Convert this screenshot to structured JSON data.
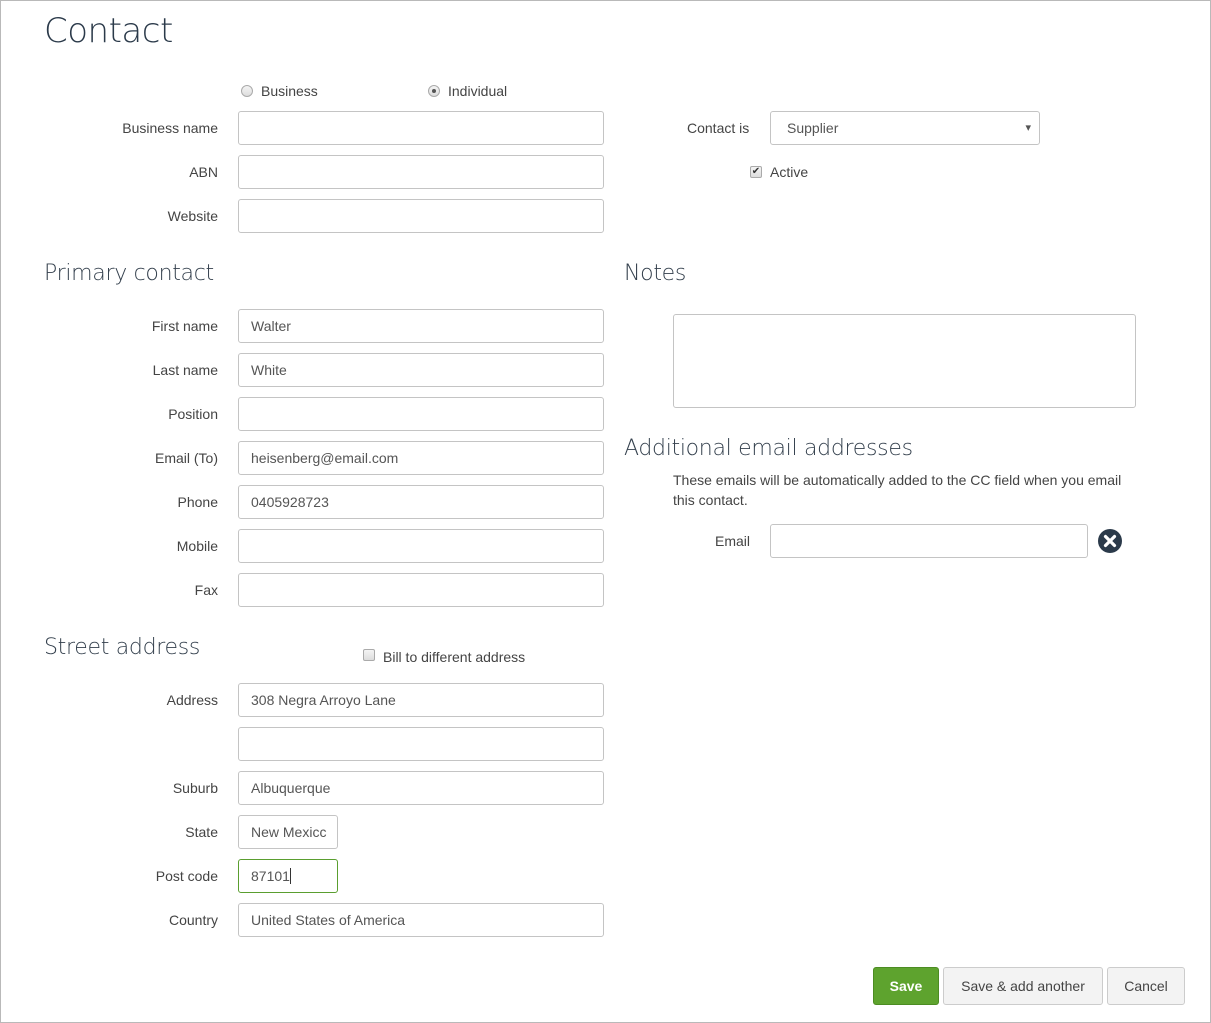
{
  "page": {
    "title": "Contact"
  },
  "contact_type": {
    "options": [
      {
        "label": "Business",
        "selected": false
      },
      {
        "label": "Individual",
        "selected": true
      }
    ]
  },
  "business": {
    "business_name": {
      "label": "Business name",
      "value": ""
    },
    "abn": {
      "label": "ABN",
      "value": ""
    },
    "website": {
      "label": "Website",
      "value": ""
    }
  },
  "contact_is": {
    "label": "Contact is",
    "value": "Supplier",
    "arrow": "▾"
  },
  "active": {
    "label": "Active",
    "checked": true,
    "mark": "✔"
  },
  "primary_contact": {
    "heading": "Primary contact",
    "fields": [
      {
        "label": "First name",
        "value": "Walter"
      },
      {
        "label": "Last name",
        "value": "White"
      },
      {
        "label": "Position",
        "value": ""
      },
      {
        "label": "Email (To)",
        "value": "heisenberg@email.com"
      },
      {
        "label": "Phone",
        "value": "0405928723"
      },
      {
        "label": "Mobile",
        "value": ""
      },
      {
        "label": "Fax",
        "value": ""
      }
    ]
  },
  "notes": {
    "heading": "Notes",
    "value": ""
  },
  "additional_emails": {
    "heading": "Additional email addresses",
    "help": "These emails will be automatically added to the CC field when you email this contact.",
    "email_label": "Email",
    "email_value": ""
  },
  "street_address": {
    "heading": "Street address",
    "bill_to_different": {
      "label": "Bill to different address",
      "checked": false
    },
    "address": {
      "label": "Address",
      "line1": "308 Negra Arroyo Lane",
      "line2": ""
    },
    "suburb": {
      "label": "Suburb",
      "value": "Albuquerque"
    },
    "state": {
      "label": "State",
      "value": "New Mexicc"
    },
    "post_code": {
      "label": "Post code",
      "value": "87101"
    },
    "country": {
      "label": "Country",
      "value": "United States of America"
    }
  },
  "actions": {
    "save": "Save",
    "save_add": "Save & add another",
    "cancel": "Cancel"
  },
  "colors": {
    "primary": "#5ea32e",
    "focus_border": "#5a9e2f",
    "heading": "#2b3a4a"
  }
}
